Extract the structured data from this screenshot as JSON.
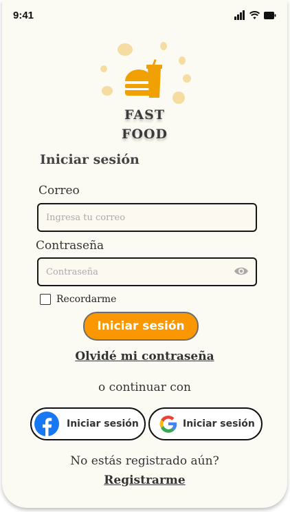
{
  "status_bar": {
    "time": "9:41"
  },
  "brand": {
    "line1": "FAST",
    "line2": "FOOD"
  },
  "login": {
    "title": "Iniciar sesión",
    "email_label": "Correo",
    "email_placeholder": "Ingresa tu correo",
    "password_label": "Contraseña",
    "password_placeholder": "Contraseña",
    "remember_label": "Recordarme",
    "submit_label": "Iniciar sesión",
    "forgot_label": "Olvidé mi contraseña"
  },
  "social": {
    "divider_text": "o continuar con",
    "facebook_label": "Iniciar sesión",
    "google_label": "Iniciar sesión"
  },
  "signup": {
    "prompt": "No estás registrado aún?",
    "link_label": "Registrarme"
  },
  "colors": {
    "accent": "#fb9700",
    "logo": "#f0a000",
    "background": "#fcfbf3"
  }
}
